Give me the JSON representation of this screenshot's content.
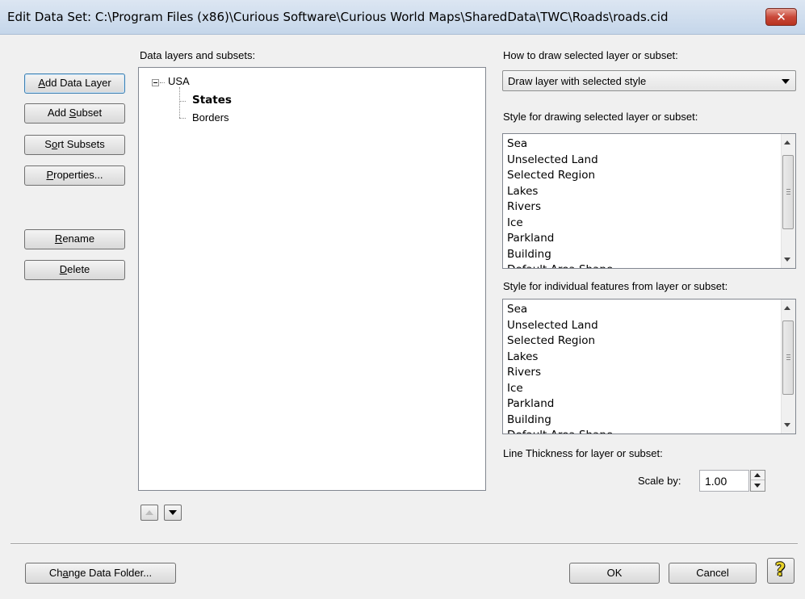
{
  "window": {
    "title": "Edit Data Set: C:\\Program Files (x86)\\Curious Software\\Curious World Maps\\SharedData\\TWC\\Roads\\roads.cid",
    "close_icon": "close-icon",
    "close_glyph": "✕"
  },
  "left_buttons": {
    "add_data_layer": {
      "pre": "",
      "key": "A",
      "post": "dd Data Layer"
    },
    "add_subset": {
      "pre": "Add ",
      "key": "S",
      "post": "ubset"
    },
    "sort_subsets": {
      "pre": "S",
      "key": "o",
      "post": "rt Subsets"
    },
    "properties": {
      "pre": "",
      "key": "P",
      "post": "roperties..."
    },
    "rename": {
      "pre": "",
      "key": "R",
      "post": "ename"
    },
    "delete": {
      "pre": "",
      "key": "D",
      "post": "elete"
    }
  },
  "tree": {
    "label": "Data layers and subsets:",
    "root": "USA",
    "children": [
      "States",
      "Borders"
    ],
    "selected": "States",
    "move_up_icon": "arrow-up-icon",
    "move_down_icon": "arrow-down-icon"
  },
  "draw": {
    "label": "How to draw selected layer or subset:",
    "selected": "Draw layer with selected style"
  },
  "style_list": {
    "label": "Style for drawing selected layer or subset:",
    "items": [
      "Sea",
      "Unselected Land",
      "Selected Region",
      "Lakes",
      "Rivers",
      "Ice",
      "Parkland",
      "Building",
      "Default Area Shape"
    ]
  },
  "feature_list": {
    "label": "Style for individual features from layer or subset:",
    "items": [
      "Sea",
      "Unselected Land",
      "Selected Region",
      "Lakes",
      "Rivers",
      "Ice",
      "Parkland",
      "Building",
      "Default Area Shape"
    ]
  },
  "thickness": {
    "label": "Line Thickness for layer or subset:",
    "scale_label": "Scale by:",
    "scale_value": "1.00"
  },
  "footer": {
    "change_folder": {
      "pre": "Ch",
      "key": "a",
      "post": "nge Data Folder..."
    },
    "ok": "OK",
    "cancel": "Cancel",
    "help_icon": "help-question-icon",
    "help_glyph": "?"
  },
  "colors": {
    "title_bar": "#c5d6ea",
    "close_button": "#c9493a",
    "dialog_bg": "#f0f0f0",
    "help_icon_yellow": "#e8d22a"
  }
}
